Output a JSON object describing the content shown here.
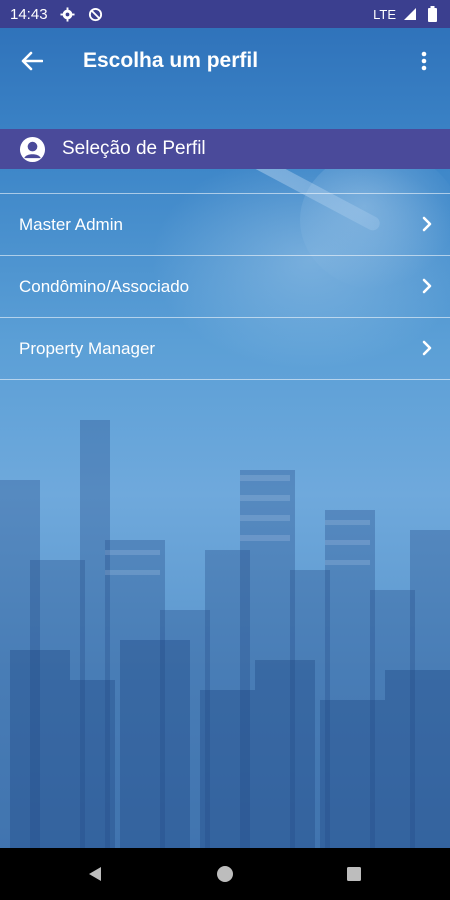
{
  "status_bar": {
    "time": "14:43",
    "network": "LTE",
    "icons": [
      "settings-icon",
      "data-saver-icon",
      "signal-icon",
      "battery-icon"
    ]
  },
  "app_bar": {
    "title": "Escolha um perfil",
    "back_icon": "arrow-left-icon",
    "menu_icon": "more-vertical-icon"
  },
  "section": {
    "title": "Seleção de Perfil",
    "icon": "user-circle-icon"
  },
  "profiles": [
    {
      "label": "Master Admin"
    },
    {
      "label": "Condômino/Associado"
    },
    {
      "label": "Property Manager"
    }
  ],
  "nav_bar": {
    "icons": [
      "back-triangle-icon",
      "home-circle-icon",
      "recents-square-icon"
    ]
  },
  "colors": {
    "status_bar": "#3b3f8f",
    "section_header": "#4a4a9a",
    "text": "#ffffff",
    "background_top": "#2d6fb8",
    "background_mid": "#6fa9dc"
  }
}
